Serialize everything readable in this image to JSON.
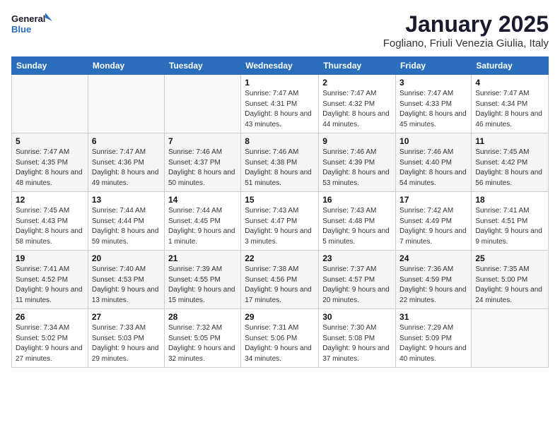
{
  "header": {
    "logo_line1": "General",
    "logo_line2": "Blue",
    "calendar_title": "January 2025",
    "calendar_subtitle": "Fogliano, Friuli Venezia Giulia, Italy"
  },
  "weekdays": [
    "Sunday",
    "Monday",
    "Tuesday",
    "Wednesday",
    "Thursday",
    "Friday",
    "Saturday"
  ],
  "weeks": [
    [
      {
        "day": null,
        "info": null
      },
      {
        "day": null,
        "info": null
      },
      {
        "day": null,
        "info": null
      },
      {
        "day": "1",
        "info": "Sunrise: 7:47 AM\nSunset: 4:31 PM\nDaylight: 8 hours and 43 minutes."
      },
      {
        "day": "2",
        "info": "Sunrise: 7:47 AM\nSunset: 4:32 PM\nDaylight: 8 hours and 44 minutes."
      },
      {
        "day": "3",
        "info": "Sunrise: 7:47 AM\nSunset: 4:33 PM\nDaylight: 8 hours and 45 minutes."
      },
      {
        "day": "4",
        "info": "Sunrise: 7:47 AM\nSunset: 4:34 PM\nDaylight: 8 hours and 46 minutes."
      }
    ],
    [
      {
        "day": "5",
        "info": "Sunrise: 7:47 AM\nSunset: 4:35 PM\nDaylight: 8 hours and 48 minutes."
      },
      {
        "day": "6",
        "info": "Sunrise: 7:47 AM\nSunset: 4:36 PM\nDaylight: 8 hours and 49 minutes."
      },
      {
        "day": "7",
        "info": "Sunrise: 7:46 AM\nSunset: 4:37 PM\nDaylight: 8 hours and 50 minutes."
      },
      {
        "day": "8",
        "info": "Sunrise: 7:46 AM\nSunset: 4:38 PM\nDaylight: 8 hours and 51 minutes."
      },
      {
        "day": "9",
        "info": "Sunrise: 7:46 AM\nSunset: 4:39 PM\nDaylight: 8 hours and 53 minutes."
      },
      {
        "day": "10",
        "info": "Sunrise: 7:46 AM\nSunset: 4:40 PM\nDaylight: 8 hours and 54 minutes."
      },
      {
        "day": "11",
        "info": "Sunrise: 7:45 AM\nSunset: 4:42 PM\nDaylight: 8 hours and 56 minutes."
      }
    ],
    [
      {
        "day": "12",
        "info": "Sunrise: 7:45 AM\nSunset: 4:43 PM\nDaylight: 8 hours and 58 minutes."
      },
      {
        "day": "13",
        "info": "Sunrise: 7:44 AM\nSunset: 4:44 PM\nDaylight: 8 hours and 59 minutes."
      },
      {
        "day": "14",
        "info": "Sunrise: 7:44 AM\nSunset: 4:45 PM\nDaylight: 9 hours and 1 minute."
      },
      {
        "day": "15",
        "info": "Sunrise: 7:43 AM\nSunset: 4:47 PM\nDaylight: 9 hours and 3 minutes."
      },
      {
        "day": "16",
        "info": "Sunrise: 7:43 AM\nSunset: 4:48 PM\nDaylight: 9 hours and 5 minutes."
      },
      {
        "day": "17",
        "info": "Sunrise: 7:42 AM\nSunset: 4:49 PM\nDaylight: 9 hours and 7 minutes."
      },
      {
        "day": "18",
        "info": "Sunrise: 7:41 AM\nSunset: 4:51 PM\nDaylight: 9 hours and 9 minutes."
      }
    ],
    [
      {
        "day": "19",
        "info": "Sunrise: 7:41 AM\nSunset: 4:52 PM\nDaylight: 9 hours and 11 minutes."
      },
      {
        "day": "20",
        "info": "Sunrise: 7:40 AM\nSunset: 4:53 PM\nDaylight: 9 hours and 13 minutes."
      },
      {
        "day": "21",
        "info": "Sunrise: 7:39 AM\nSunset: 4:55 PM\nDaylight: 9 hours and 15 minutes."
      },
      {
        "day": "22",
        "info": "Sunrise: 7:38 AM\nSunset: 4:56 PM\nDaylight: 9 hours and 17 minutes."
      },
      {
        "day": "23",
        "info": "Sunrise: 7:37 AM\nSunset: 4:57 PM\nDaylight: 9 hours and 20 minutes."
      },
      {
        "day": "24",
        "info": "Sunrise: 7:36 AM\nSunset: 4:59 PM\nDaylight: 9 hours and 22 minutes."
      },
      {
        "day": "25",
        "info": "Sunrise: 7:35 AM\nSunset: 5:00 PM\nDaylight: 9 hours and 24 minutes."
      }
    ],
    [
      {
        "day": "26",
        "info": "Sunrise: 7:34 AM\nSunset: 5:02 PM\nDaylight: 9 hours and 27 minutes."
      },
      {
        "day": "27",
        "info": "Sunrise: 7:33 AM\nSunset: 5:03 PM\nDaylight: 9 hours and 29 minutes."
      },
      {
        "day": "28",
        "info": "Sunrise: 7:32 AM\nSunset: 5:05 PM\nDaylight: 9 hours and 32 minutes."
      },
      {
        "day": "29",
        "info": "Sunrise: 7:31 AM\nSunset: 5:06 PM\nDaylight: 9 hours and 34 minutes."
      },
      {
        "day": "30",
        "info": "Sunrise: 7:30 AM\nSunset: 5:08 PM\nDaylight: 9 hours and 37 minutes."
      },
      {
        "day": "31",
        "info": "Sunrise: 7:29 AM\nSunset: 5:09 PM\nDaylight: 9 hours and 40 minutes."
      },
      {
        "day": null,
        "info": null
      }
    ]
  ]
}
